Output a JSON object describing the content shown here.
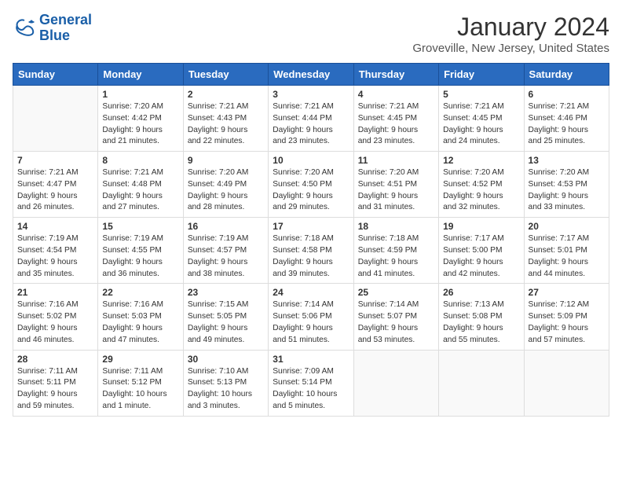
{
  "logo": {
    "line1": "General",
    "line2": "Blue"
  },
  "title": "January 2024",
  "subtitle": "Groveville, New Jersey, United States",
  "days_of_week": [
    "Sunday",
    "Monday",
    "Tuesday",
    "Wednesday",
    "Thursday",
    "Friday",
    "Saturday"
  ],
  "weeks": [
    [
      {
        "day": "",
        "info": ""
      },
      {
        "day": "1",
        "info": "Sunrise: 7:20 AM\nSunset: 4:42 PM\nDaylight: 9 hours\nand 21 minutes."
      },
      {
        "day": "2",
        "info": "Sunrise: 7:21 AM\nSunset: 4:43 PM\nDaylight: 9 hours\nand 22 minutes."
      },
      {
        "day": "3",
        "info": "Sunrise: 7:21 AM\nSunset: 4:44 PM\nDaylight: 9 hours\nand 23 minutes."
      },
      {
        "day": "4",
        "info": "Sunrise: 7:21 AM\nSunset: 4:45 PM\nDaylight: 9 hours\nand 23 minutes."
      },
      {
        "day": "5",
        "info": "Sunrise: 7:21 AM\nSunset: 4:45 PM\nDaylight: 9 hours\nand 24 minutes."
      },
      {
        "day": "6",
        "info": "Sunrise: 7:21 AM\nSunset: 4:46 PM\nDaylight: 9 hours\nand 25 minutes."
      }
    ],
    [
      {
        "day": "7",
        "info": "Sunrise: 7:21 AM\nSunset: 4:47 PM\nDaylight: 9 hours\nand 26 minutes."
      },
      {
        "day": "8",
        "info": "Sunrise: 7:21 AM\nSunset: 4:48 PM\nDaylight: 9 hours\nand 27 minutes."
      },
      {
        "day": "9",
        "info": "Sunrise: 7:20 AM\nSunset: 4:49 PM\nDaylight: 9 hours\nand 28 minutes."
      },
      {
        "day": "10",
        "info": "Sunrise: 7:20 AM\nSunset: 4:50 PM\nDaylight: 9 hours\nand 29 minutes."
      },
      {
        "day": "11",
        "info": "Sunrise: 7:20 AM\nSunset: 4:51 PM\nDaylight: 9 hours\nand 31 minutes."
      },
      {
        "day": "12",
        "info": "Sunrise: 7:20 AM\nSunset: 4:52 PM\nDaylight: 9 hours\nand 32 minutes."
      },
      {
        "day": "13",
        "info": "Sunrise: 7:20 AM\nSunset: 4:53 PM\nDaylight: 9 hours\nand 33 minutes."
      }
    ],
    [
      {
        "day": "14",
        "info": "Sunrise: 7:19 AM\nSunset: 4:54 PM\nDaylight: 9 hours\nand 35 minutes."
      },
      {
        "day": "15",
        "info": "Sunrise: 7:19 AM\nSunset: 4:55 PM\nDaylight: 9 hours\nand 36 minutes."
      },
      {
        "day": "16",
        "info": "Sunrise: 7:19 AM\nSunset: 4:57 PM\nDaylight: 9 hours\nand 38 minutes."
      },
      {
        "day": "17",
        "info": "Sunrise: 7:18 AM\nSunset: 4:58 PM\nDaylight: 9 hours\nand 39 minutes."
      },
      {
        "day": "18",
        "info": "Sunrise: 7:18 AM\nSunset: 4:59 PM\nDaylight: 9 hours\nand 41 minutes."
      },
      {
        "day": "19",
        "info": "Sunrise: 7:17 AM\nSunset: 5:00 PM\nDaylight: 9 hours\nand 42 minutes."
      },
      {
        "day": "20",
        "info": "Sunrise: 7:17 AM\nSunset: 5:01 PM\nDaylight: 9 hours\nand 44 minutes."
      }
    ],
    [
      {
        "day": "21",
        "info": "Sunrise: 7:16 AM\nSunset: 5:02 PM\nDaylight: 9 hours\nand 46 minutes."
      },
      {
        "day": "22",
        "info": "Sunrise: 7:16 AM\nSunset: 5:03 PM\nDaylight: 9 hours\nand 47 minutes."
      },
      {
        "day": "23",
        "info": "Sunrise: 7:15 AM\nSunset: 5:05 PM\nDaylight: 9 hours\nand 49 minutes."
      },
      {
        "day": "24",
        "info": "Sunrise: 7:14 AM\nSunset: 5:06 PM\nDaylight: 9 hours\nand 51 minutes."
      },
      {
        "day": "25",
        "info": "Sunrise: 7:14 AM\nSunset: 5:07 PM\nDaylight: 9 hours\nand 53 minutes."
      },
      {
        "day": "26",
        "info": "Sunrise: 7:13 AM\nSunset: 5:08 PM\nDaylight: 9 hours\nand 55 minutes."
      },
      {
        "day": "27",
        "info": "Sunrise: 7:12 AM\nSunset: 5:09 PM\nDaylight: 9 hours\nand 57 minutes."
      }
    ],
    [
      {
        "day": "28",
        "info": "Sunrise: 7:11 AM\nSunset: 5:11 PM\nDaylight: 9 hours\nand 59 minutes."
      },
      {
        "day": "29",
        "info": "Sunrise: 7:11 AM\nSunset: 5:12 PM\nDaylight: 10 hours\nand 1 minute."
      },
      {
        "day": "30",
        "info": "Sunrise: 7:10 AM\nSunset: 5:13 PM\nDaylight: 10 hours\nand 3 minutes."
      },
      {
        "day": "31",
        "info": "Sunrise: 7:09 AM\nSunset: 5:14 PM\nDaylight: 10 hours\nand 5 minutes."
      },
      {
        "day": "",
        "info": ""
      },
      {
        "day": "",
        "info": ""
      },
      {
        "day": "",
        "info": ""
      }
    ]
  ]
}
